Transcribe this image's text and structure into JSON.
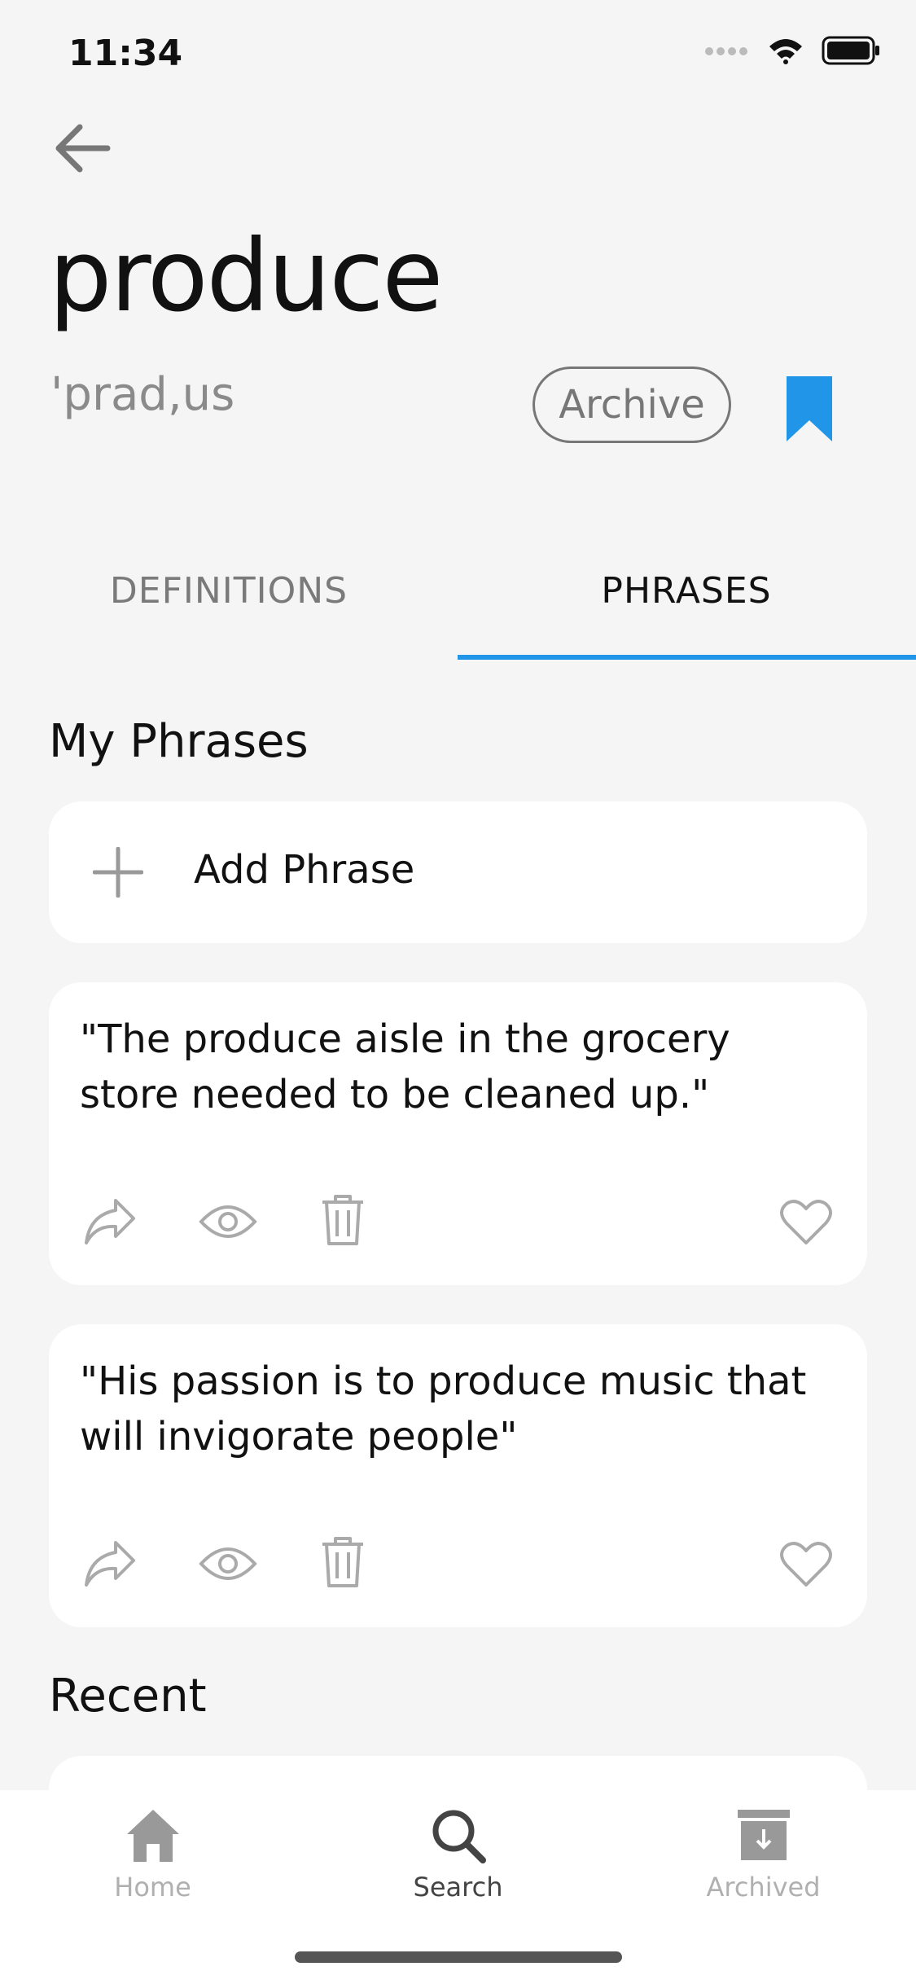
{
  "status_bar": {
    "time": "11:34"
  },
  "header": {
    "word": "produce",
    "phonetic": "'prad,us",
    "archive_label": "Archive",
    "bookmark_color": "#2196e8"
  },
  "tabs": [
    {
      "label": "DEFINITIONS",
      "active": false
    },
    {
      "label": "PHRASES",
      "active": true
    }
  ],
  "my_phrases": {
    "title": "My Phrases",
    "add_label": "Add Phrase",
    "items": [
      {
        "text": "\"The produce aisle in the grocery store needed to be cleaned up.\""
      },
      {
        "text": "\"His passion is to produce music that will invigorate people\""
      }
    ]
  },
  "recent": {
    "title": "Recent"
  },
  "bottom_nav": [
    {
      "label": "Home",
      "icon": "home-icon",
      "active": false
    },
    {
      "label": "Search",
      "icon": "search-icon",
      "active": true
    },
    {
      "label": "Archived",
      "icon": "archive-box-icon",
      "active": false
    }
  ],
  "colors": {
    "accent": "#2196e8",
    "background": "#f5f5f5",
    "card": "#ffffff"
  }
}
